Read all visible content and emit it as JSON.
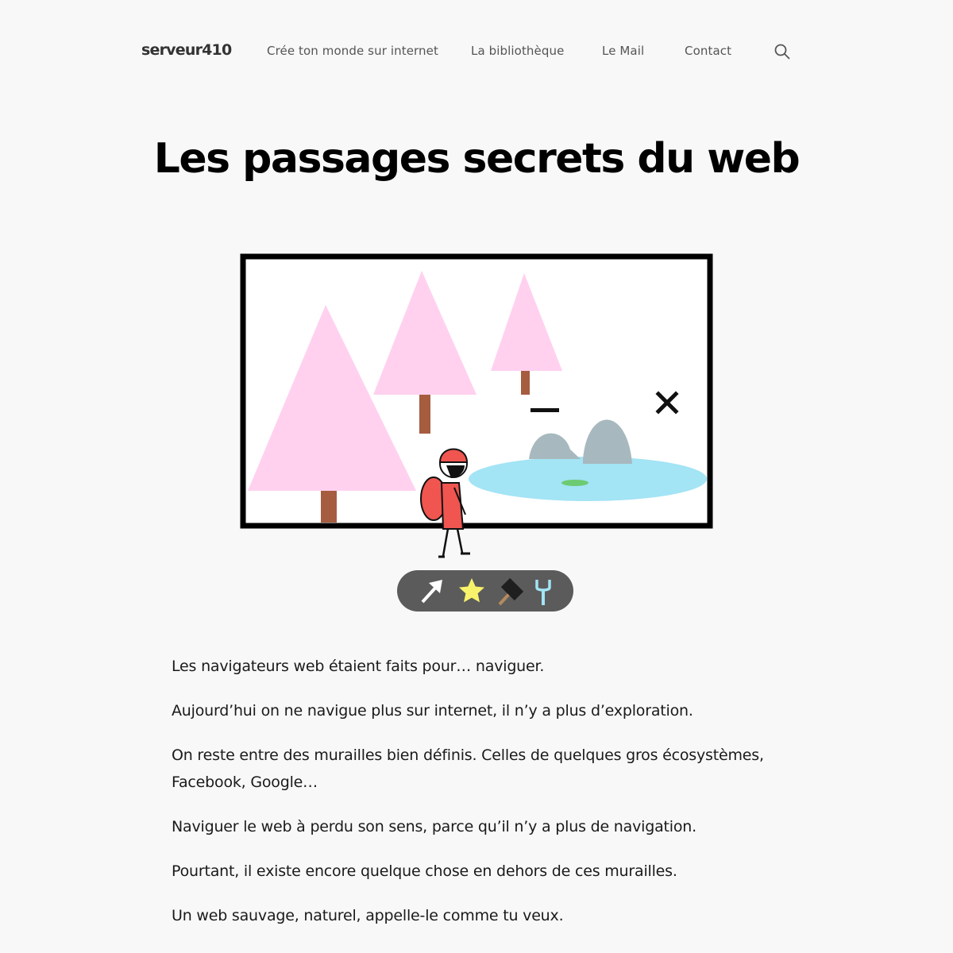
{
  "header": {
    "logo": "serveur410",
    "nav": [
      {
        "label": "Crée ton monde sur internet"
      },
      {
        "label": "La bibliothèque"
      },
      {
        "label": "Le Mail"
      },
      {
        "label": "Contact"
      }
    ],
    "search_icon": "search-icon"
  },
  "article": {
    "title": "Les passages secrets du web",
    "paragraphs": [
      "Les navigateurs web étaient faits pour… naviguer.",
      "Aujourd’hui on ne navigue plus sur internet, il n’y a plus d’exploration.",
      "On reste entre des murailles bien définis. Celles de quelques gros écosystèmes, Facebook, Google…",
      "Naviguer le web à perdu son sens, parce qu’il n’y a plus de navigation.",
      "Pourtant, il existe encore quelque chose en dehors de ces murailles.",
      "Un web sauvage, naturel, appelle-le comme tu veux."
    ]
  },
  "illustration": {
    "icons": [
      "arrow-cursor-icon",
      "star-icon",
      "hammer-icon",
      "wrench-icon"
    ],
    "colors": {
      "tree": "#ffd1ef",
      "trunk": "#a55c3f",
      "lake": "#a3e4f5",
      "rock": "#a8b8bf",
      "character": "#f0554f",
      "toolbar": "#5b5b5b",
      "star": "#f9f36b"
    }
  }
}
